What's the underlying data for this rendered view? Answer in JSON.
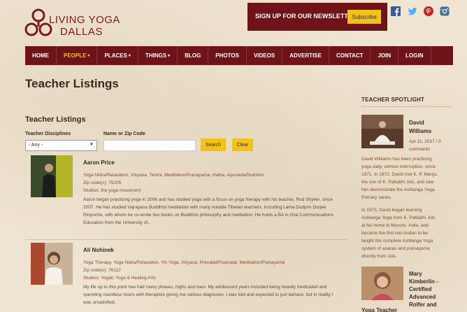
{
  "brand": {
    "line1": "LIVING YOGA",
    "line2": "DALLAS"
  },
  "newsletter": {
    "text": "SIGN UP FOR OUR NEWSLETTER",
    "button": "Subscribe"
  },
  "social": [
    "facebook-icon",
    "twitter-icon",
    "pinterest-icon",
    "instagram-icon"
  ],
  "nav": [
    {
      "label": "HOME"
    },
    {
      "label": "PEOPLE",
      "suffix": "▾",
      "active": true
    },
    {
      "label": "PLACES",
      "suffix": "▾"
    },
    {
      "label": "THINGS",
      "suffix": "▾"
    },
    {
      "label": "BLOG"
    },
    {
      "label": "PHOTOS"
    },
    {
      "label": "VIDEOS"
    },
    {
      "label": "ADVERTISE"
    },
    {
      "label": "CONTACT"
    },
    {
      "label": "JOIN"
    },
    {
      "label": "LOGIN"
    }
  ],
  "page": {
    "title": "Teacher Listings",
    "subtitle": "Teacher Listings"
  },
  "filters": {
    "disciplines_label": "Teacher Disciplines",
    "disciplines_value": "- Any -",
    "zip_label": "Name or Zip Code",
    "search_button": "Search",
    "clear_button": "Clear"
  },
  "teachers": [
    {
      "name": "Aaron Price",
      "disciplines": "Yoga Nidra/Relaxation, Vinyasa, Tantra, Meditation/Pranayama, Hatha, Ayurveda/Nutrition",
      "zip": "Zip code(s): 75205",
      "studios": "Studios: the yoga movement",
      "bio": "Aaron began practicing yoga in 2006 and has studied yoga with a focus on yoga therapy with his teacher, Rod Stryker, since 2007. He has studied Vajrayana Buddhist meditation with many notable Tibetan teachers, including Lama Dudjom Dorjee Rinpoche, with whom he co-wrote two books on Buddhist philosophy and meditation. He holds a BA in Oral Communications Education from the University of..."
    },
    {
      "name": "Ali Nohinek",
      "disciplines": "Yoga Therapy, Yoga Nidra/Relaxation, Yin Yoga, Vinyasa, Prenatal/Postnatal, Meditation/Pranayama",
      "zip": "Zip code(s): 76112",
      "studios": "Studios: Yogail; Yoga & Healing Arts",
      "bio": "My life up to this point has had many phases, highs and lows.  My adolescent years included being heavily medicated and spending countless hours with therapists giving me various diagnoses. I was told and expected to just behave, but in reality I was unsatisfied."
    }
  ],
  "sidebar": {
    "heading": "TEACHER SPOTLIGHT",
    "spot1": {
      "name_line1": "David",
      "name_line2": "Williams",
      "date": "Apr 11, 2017 / 0",
      "comments": "comments",
      "para1_l1": "David Williams has been practicing",
      "para1_l2": "yoga daily, without interruption, since",
      "para1_l3": "1971. In 1972, David met K. P. Manju,",
      "para1_l4": "the son of K. Pattabhi Jois, and saw",
      "para1_l5": "him demonstrate the Ashtanga Yoga",
      "para1_l6": "Primary series.",
      "para2_l1": "In 1973, David began learning",
      "para2_l2": "Ashtanga Yoga from K. Pattabhi Jois",
      "para2_l3": "at his home in Mysore, India, and",
      "para2_l4": "became the first non-Indian to be",
      "para2_l5": "taught the complete Ashtanga Yoga",
      "para2_l6": "system of asanas and pranayama",
      "para2_l7": "directly from Jois."
    },
    "spot2": {
      "l1": "Mary",
      "l2": "Kimberlin -",
      "l3": "Certified",
      "l4": "Advanced",
      "l5": "Rolfer and",
      "l6": "Yoga Teacher"
    }
  },
  "colors": {
    "brand": "#6e1419",
    "accent": "#f1c21a",
    "link": "#8a4a28",
    "background": "#efe5d2"
  }
}
